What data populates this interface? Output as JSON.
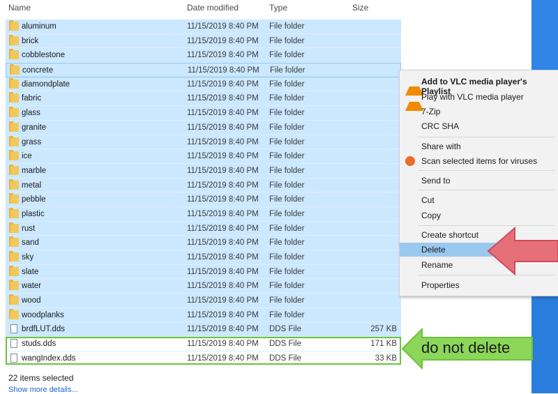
{
  "header": {
    "name": "Name",
    "date": "Date modified",
    "type": "Type",
    "size": "Size"
  },
  "rows": [
    {
      "name": "aluminum",
      "date": "11/15/2019 8:40 PM",
      "type": "File folder",
      "size": "",
      "kind": "folder"
    },
    {
      "name": "brick",
      "date": "11/15/2019 8:40 PM",
      "type": "File folder",
      "size": "",
      "kind": "folder"
    },
    {
      "name": "cobblestone",
      "date": "11/15/2019 8:40 PM",
      "type": "File folder",
      "size": "",
      "kind": "folder"
    },
    {
      "name": "concrete",
      "date": "11/15/2019 8:40 PM",
      "type": "File folder",
      "size": "",
      "kind": "folder",
      "focused": true
    },
    {
      "name": "diamondplate",
      "date": "11/15/2019 8:40 PM",
      "type": "File folder",
      "size": "",
      "kind": "folder"
    },
    {
      "name": "fabric",
      "date": "11/15/2019 8:40 PM",
      "type": "File folder",
      "size": "",
      "kind": "folder"
    },
    {
      "name": "glass",
      "date": "11/15/2019 8:40 PM",
      "type": "File folder",
      "size": "",
      "kind": "folder"
    },
    {
      "name": "granite",
      "date": "11/15/2019 8:40 PM",
      "type": "File folder",
      "size": "",
      "kind": "folder"
    },
    {
      "name": "grass",
      "date": "11/15/2019 8:40 PM",
      "type": "File folder",
      "size": "",
      "kind": "folder"
    },
    {
      "name": "ice",
      "date": "11/15/2019 8:40 PM",
      "type": "File folder",
      "size": "",
      "kind": "folder"
    },
    {
      "name": "marble",
      "date": "11/15/2019 8:40 PM",
      "type": "File folder",
      "size": "",
      "kind": "folder"
    },
    {
      "name": "metal",
      "date": "11/15/2019 8:40 PM",
      "type": "File folder",
      "size": "",
      "kind": "folder"
    },
    {
      "name": "pebble",
      "date": "11/15/2019 8:40 PM",
      "type": "File folder",
      "size": "",
      "kind": "folder"
    },
    {
      "name": "plastic",
      "date": "11/15/2019 8:40 PM",
      "type": "File folder",
      "size": "",
      "kind": "folder"
    },
    {
      "name": "rust",
      "date": "11/15/2019 8:40 PM",
      "type": "File folder",
      "size": "",
      "kind": "folder"
    },
    {
      "name": "sand",
      "date": "11/15/2019 8:40 PM",
      "type": "File folder",
      "size": "",
      "kind": "folder"
    },
    {
      "name": "sky",
      "date": "11/15/2019 8:40 PM",
      "type": "File folder",
      "size": "",
      "kind": "folder"
    },
    {
      "name": "slate",
      "date": "11/15/2019 8:40 PM",
      "type": "File folder",
      "size": "",
      "kind": "folder"
    },
    {
      "name": "water",
      "date": "11/15/2019 8:40 PM",
      "type": "File folder",
      "size": "",
      "kind": "folder"
    },
    {
      "name": "wood",
      "date": "11/15/2019 8:40 PM",
      "type": "File folder",
      "size": "",
      "kind": "folder"
    },
    {
      "name": "woodplanks",
      "date": "11/15/2019 8:40 PM",
      "type": "File folder",
      "size": "",
      "kind": "folder"
    },
    {
      "name": "brdfLUT.dds",
      "date": "11/15/2019 8:40 PM",
      "type": "DDS File",
      "size": "257 KB",
      "kind": "file"
    },
    {
      "name": "studs.dds",
      "date": "11/15/2019 8:40 PM",
      "type": "DDS File",
      "size": "171 KB",
      "kind": "file",
      "unselected": true
    },
    {
      "name": "wangIndex.dds",
      "date": "11/15/2019 8:40 PM",
      "type": "DDS File",
      "size": "33 KB",
      "kind": "file",
      "unselected": true
    }
  ],
  "status": {
    "selected": "22 items selected",
    "more": "Show more details..."
  },
  "context_menu": [
    {
      "label": "Add to VLC media player's Playlist",
      "icon": "vlc-icon",
      "bold": true
    },
    {
      "label": "Play with VLC media player",
      "icon": "vlc-icon"
    },
    {
      "label": "7-Zip"
    },
    {
      "label": "CRC SHA"
    },
    {
      "label": "Share with",
      "separator_before": true
    },
    {
      "label": "Scan selected items for viruses",
      "icon": "scan-icon"
    },
    {
      "label": "Send to",
      "separator_before": true
    },
    {
      "label": "Cut",
      "separator_before": true
    },
    {
      "label": "Copy"
    },
    {
      "label": "Create shortcut",
      "separator_before": true
    },
    {
      "label": "Delete",
      "highlighted": true
    },
    {
      "label": "Rename"
    },
    {
      "label": "Properties",
      "separator_before": true
    }
  ],
  "annotation": {
    "note": "do not delete"
  },
  "colors": {
    "selection": "#cce8ff",
    "menu_highlight": "#9bc8ee",
    "green": "#6ac23a",
    "red_arrow": "#e5707a",
    "green_arrow": "#8cd65a"
  }
}
